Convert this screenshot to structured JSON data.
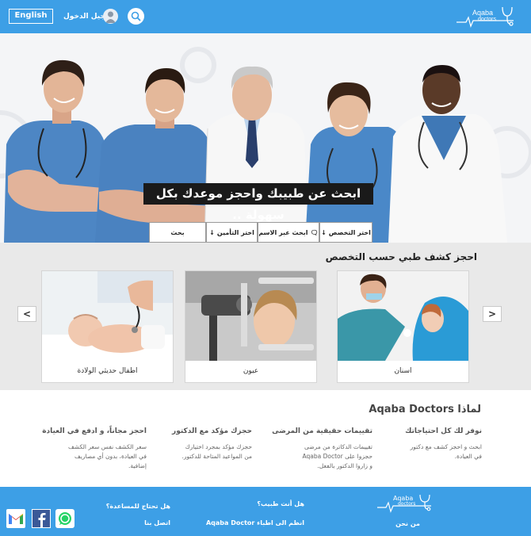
{
  "header": {
    "lang_button": "English",
    "login_label": "تسجيل الدخول",
    "logo_text": "Aqaba",
    "logo_sub": "doctors"
  },
  "hero": {
    "title": "ابحث عن طبيبك واحجز موعدك بكل سهولة ..",
    "search": {
      "specialty": "اختر التخصص",
      "by_name": "ابحث عبر الاسم",
      "insurance": "اختر التأمين",
      "search": "بحث"
    }
  },
  "specialties": {
    "title": "احجز كشف طبي حسب التخصص",
    "prev": "<",
    "next": ">",
    "cards": [
      {
        "label": "اسنان"
      },
      {
        "label": "عيون"
      },
      {
        "label": "اطفال حديثي الولادة"
      }
    ]
  },
  "why": {
    "title": "لماذا Aqaba Doctors",
    "features": [
      {
        "title": "نوفر لك كل احتياجاتك",
        "lines": [
          "ابحث و احجز كشف مع دكتور",
          "في العيادة."
        ]
      },
      {
        "title": "تقييمات حقيقية من المرضى",
        "lines": [
          "تقييمات الدكاترة من مرضى",
          "حجزوا على Aqaba Doctor",
          "و زاروا الدكتور بالفعل."
        ]
      },
      {
        "title": "حجزك مؤكد مع الدكتور",
        "lines": [
          "حجزك مؤكد بمجرد اختيارك",
          "من المواعيد المتاحة للدكتور."
        ]
      },
      {
        "title": "احجز مجاناً، و ادفع في العيادة",
        "lines": [
          "سعر الكشف نفس سعر الكشف",
          "في العيادة، بدون أي مصاريف",
          "إضافية."
        ]
      }
    ]
  },
  "footer": {
    "logo_text": "Aqaba",
    "logo_sub": "doctors",
    "about": "من نحن",
    "are_you_doctor": "هل أنت طبيب؟",
    "join": "انظم الى اطباء Aqaba Doctor",
    "need_help": "هل تحتاج للمساعدة؟",
    "contact": "اتصل بنا"
  },
  "colors": {
    "brand": "#3d9fe6",
    "scrubs": "#4a82c0",
    "spec_bg": "#e9e9e9"
  }
}
